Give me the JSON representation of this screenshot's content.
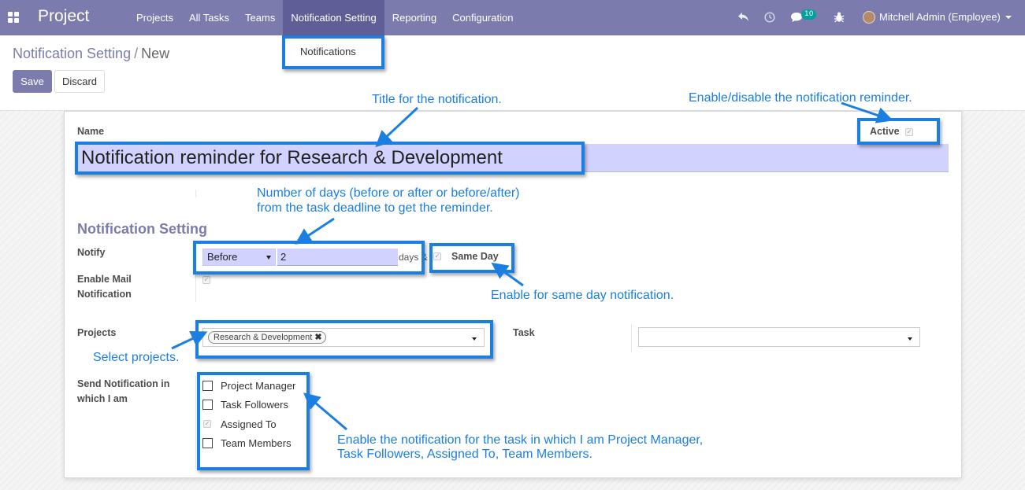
{
  "navbar": {
    "app_name": "Project",
    "menu": [
      "Projects",
      "All Tasks",
      "Teams",
      "Notification Setting",
      "Reporting",
      "Configuration"
    ],
    "active_menu": "Notification Setting",
    "chat_badge": "10",
    "user": "Mitchell Admin (Employee)"
  },
  "dropdown": {
    "item": "Notifications"
  },
  "breadcrumb": {
    "parent": "Notification Setting",
    "separator": "/",
    "current": "New"
  },
  "buttons": {
    "save": "Save",
    "discard": "Discard"
  },
  "form": {
    "name_label": "Name",
    "name_value": "Notification reminder for Research & Development",
    "active_label": "Active",
    "active_checked": true,
    "section_title": "Notification Setting",
    "notify_label": "Notify",
    "notify_select": "Before",
    "notify_days": "2",
    "days_suffix": "days &",
    "same_day_label": "Same Day",
    "enable_mail_label_1": "Enable Mail",
    "enable_mail_label_2": "Notification",
    "projects_label": "Projects",
    "project_tag": "Research & Development",
    "task_label": "Task",
    "send_label_1": "Send Notification in",
    "send_label_2": "which I am",
    "roles": [
      {
        "label": "Project Manager",
        "checked": false
      },
      {
        "label": "Task Followers",
        "checked": false
      },
      {
        "label": "Assigned To",
        "checked": true
      },
      {
        "label": "Team Members",
        "checked": false
      }
    ]
  },
  "annotations": {
    "title_note": "Title for the notification.",
    "active_note": "Enable/disable the notification reminder.",
    "days_note_1": "Number of days (before or after or before/after)",
    "days_note_2": "from the task deadline to get the reminder.",
    "same_day_note": "Enable for same day notification.",
    "projects_note": "Select projects.",
    "roles_note_1": "Enable the notification for the task in which I am Project Manager,",
    "roles_note_2": "Task Followers, Assigned To, Team Members."
  },
  "colors": {
    "navbar": "#7c7bad",
    "active_menu": "#5f5e97",
    "annotation": "#1a7fe0",
    "input_bg": "#d2d2ff",
    "badge": "#00a09d"
  },
  "icons": [
    "apps-grid-icon",
    "reply-icon",
    "clock-icon",
    "chat-icon",
    "bug-icon",
    "avatar",
    "caret-down-icon",
    "checkmark-icon",
    "remove-icon"
  ]
}
